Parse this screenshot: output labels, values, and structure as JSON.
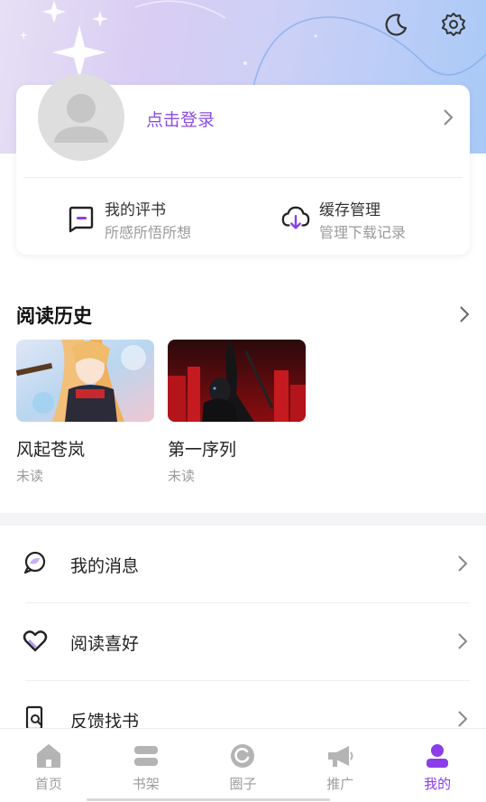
{
  "header": {
    "moon_icon": "moon-icon",
    "settings_icon": "gear-icon"
  },
  "profile": {
    "login_label": "点击登录",
    "quick_actions": [
      {
        "title": "我的评书",
        "subtitle": "所感所悟所想",
        "icon": "comment-icon"
      },
      {
        "title": "缓存管理",
        "subtitle": "管理下载记录",
        "icon": "cloud-download-icon"
      }
    ]
  },
  "history": {
    "title": "阅读历史",
    "books": [
      {
        "title": "风起苍岚",
        "status": "未读"
      },
      {
        "title": "第一序列",
        "status": "未读"
      }
    ]
  },
  "menu": [
    {
      "label": "我的消息",
      "icon": "message-icon"
    },
    {
      "label": "阅读喜好",
      "icon": "heart-icon"
    },
    {
      "label": "反馈找书",
      "icon": "search-book-icon"
    }
  ],
  "tabs": [
    {
      "label": "首页",
      "icon": "home-icon",
      "active": false
    },
    {
      "label": "书架",
      "icon": "bookshelf-icon",
      "active": false
    },
    {
      "label": "圈子",
      "icon": "circle-icon",
      "active": false
    },
    {
      "label": "推广",
      "icon": "megaphone-icon",
      "active": false
    },
    {
      "label": "我的",
      "icon": "user-icon",
      "active": true
    }
  ],
  "colors": {
    "accent": "#8a3de8",
    "login_text": "#8a4de0",
    "inactive_tab": "#b4b4b4"
  }
}
